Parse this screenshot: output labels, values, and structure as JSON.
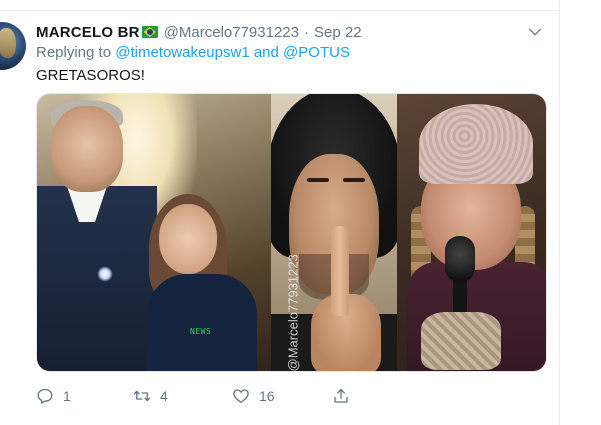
{
  "tweet": {
    "display_name": "MARCELO BR",
    "flag_icon": "brazil-flag-icon",
    "handle": "@Marcelo77931223",
    "separator": "·",
    "date": "Sep 22",
    "reply_prefix": "Replying to",
    "reply_to_1": "@timetowakeupsw1",
    "reply_and": "and",
    "reply_to_2": "@POTUS",
    "text": "GRETASOROS!",
    "media": {
      "panel_1_watermark": "NEWS",
      "panel_2_watermark": "@Marcelo77931223"
    },
    "actions": {
      "reply_count": "1",
      "retweet_count": "4",
      "like_count": "16"
    }
  },
  "colors": {
    "link": "#1da1f2",
    "secondary_text": "#657786",
    "primary_text": "#14171a"
  }
}
